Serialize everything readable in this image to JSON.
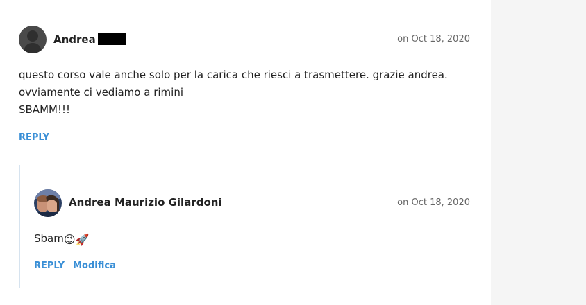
{
  "comments": [
    {
      "author": "Andrea",
      "date": "on Oct 18, 2020",
      "lines": [
        "questo corso vale anche solo per la carica che riesci a trasmettere. grazie andrea.",
        "ovviamente ci vediamo a rimini",
        "SBAMM!!!"
      ],
      "reply_label": "REPLY",
      "avatar_icon": "person-silhouette-icon"
    },
    {
      "author": "Andrea Maurizio Gilardoni",
      "date": "on Oct 18, 2020",
      "text": "Sbam",
      "emojis": [
        "😉",
        "🚀"
      ],
      "reply_label": "REPLY",
      "edit_label": "Modifica",
      "avatar_icon": "user-photo-avatar"
    }
  ],
  "colors": {
    "link": "#3a8fd6",
    "thread_line": "#d6e3ef",
    "side_panel": "#f5f5f5"
  }
}
